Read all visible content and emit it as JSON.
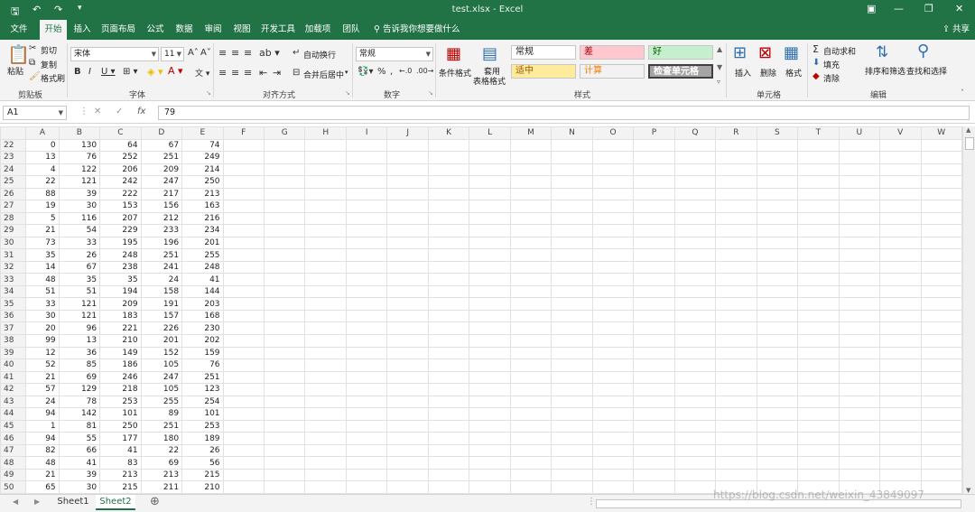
{
  "window": {
    "title": "test.xlsx  -  Excel",
    "save_icon": "save-icon",
    "undo_icon": "undo-icon",
    "redo_icon": "redo-icon",
    "customize_icon": "qat-customize-icon"
  },
  "tabs": [
    "文件",
    "开始",
    "插入",
    "页面布局",
    "公式",
    "数据",
    "审阅",
    "视图",
    "开发工具",
    "加载项",
    "团队"
  ],
  "tell_me": "告诉我你想要做什么",
  "share": "共享",
  "ribbon": {
    "clipboard": {
      "label": "剪贴板",
      "paste": "粘贴",
      "cut": "剪切",
      "copy": "复制",
      "format_painter": "格式刷"
    },
    "font": {
      "label": "字体",
      "name": "宋体",
      "size": "11"
    },
    "alignment": {
      "label": "对齐方式",
      "wrap": "自动换行",
      "merge": "合并后居中"
    },
    "number": {
      "label": "数字",
      "format": "常规"
    },
    "styles": {
      "label": "样式",
      "conditional": "条件格式",
      "table_format_1": "套用",
      "table_format_2": "表格格式",
      "cells": [
        {
          "text": "常规",
          "bg": "#ffffff",
          "color": "#222222"
        },
        {
          "text": "差",
          "bg": "#ffc7ce",
          "color": "#9c0006"
        },
        {
          "text": "好",
          "bg": "#c6efce",
          "color": "#006100"
        },
        {
          "text": "适中",
          "bg": "#ffeb9c",
          "color": "#9c5700"
        },
        {
          "text": "计算",
          "bg": "#f2f2f2",
          "color": "#fa7d00"
        },
        {
          "text": "检查单元格",
          "bg": "#a5a5a5",
          "color": "#ffffff"
        }
      ]
    },
    "cells": {
      "label": "单元格",
      "insert": "插入",
      "delete": "删除",
      "format": "格式"
    },
    "editing": {
      "label": "编辑",
      "autosum": "自动求和",
      "fill": "填充",
      "clear": "清除",
      "sort_filter": "排序和筛选",
      "find_select": "查找和选择"
    }
  },
  "formula_bar": {
    "name_box": "A1",
    "cancel": "✕",
    "enter": "✓",
    "fx": "fx",
    "value": "79"
  },
  "columns": [
    "A",
    "B",
    "C",
    "D",
    "E",
    "F",
    "G",
    "H",
    "I",
    "J",
    "K",
    "L",
    "M",
    "N",
    "O",
    "P",
    "Q",
    "R",
    "S",
    "T",
    "U",
    "V",
    "W"
  ],
  "rows": [
    {
      "n": 22,
      "v": [
        0,
        130,
        64,
        67,
        74
      ]
    },
    {
      "n": 23,
      "v": [
        13,
        76,
        252,
        251,
        249
      ]
    },
    {
      "n": 24,
      "v": [
        4,
        122,
        206,
        209,
        214
      ]
    },
    {
      "n": 25,
      "v": [
        22,
        121,
        242,
        247,
        250
      ]
    },
    {
      "n": 26,
      "v": [
        88,
        39,
        222,
        217,
        213
      ]
    },
    {
      "n": 27,
      "v": [
        19,
        30,
        153,
        156,
        163
      ]
    },
    {
      "n": 28,
      "v": [
        5,
        116,
        207,
        212,
        216
      ]
    },
    {
      "n": 29,
      "v": [
        21,
        54,
        229,
        233,
        234
      ]
    },
    {
      "n": 30,
      "v": [
        73,
        33,
        195,
        196,
        201
      ]
    },
    {
      "n": 31,
      "v": [
        35,
        26,
        248,
        251,
        255
      ]
    },
    {
      "n": 32,
      "v": [
        14,
        67,
        238,
        241,
        248
      ]
    },
    {
      "n": 33,
      "v": [
        48,
        35,
        35,
        24,
        41
      ]
    },
    {
      "n": 34,
      "v": [
        51,
        51,
        194,
        158,
        144
      ]
    },
    {
      "n": 35,
      "v": [
        33,
        121,
        209,
        191,
        203
      ]
    },
    {
      "n": 36,
      "v": [
        30,
        121,
        183,
        157,
        168
      ]
    },
    {
      "n": 37,
      "v": [
        20,
        96,
        221,
        226,
        230
      ]
    },
    {
      "n": 38,
      "v": [
        99,
        13,
        210,
        201,
        202
      ]
    },
    {
      "n": 39,
      "v": [
        12,
        36,
        149,
        152,
        159
      ]
    },
    {
      "n": 40,
      "v": [
        52,
        85,
        186,
        105,
        76
      ]
    },
    {
      "n": 41,
      "v": [
        21,
        69,
        246,
        247,
        251
      ]
    },
    {
      "n": 42,
      "v": [
        57,
        129,
        218,
        105,
        123
      ]
    },
    {
      "n": 43,
      "v": [
        24,
        78,
        253,
        255,
        254
      ]
    },
    {
      "n": 44,
      "v": [
        94,
        142,
        101,
        89,
        101
      ]
    },
    {
      "n": 45,
      "v": [
        1,
        81,
        250,
        251,
        253
      ]
    },
    {
      "n": 46,
      "v": [
        94,
        55,
        177,
        180,
        189
      ]
    },
    {
      "n": 47,
      "v": [
        82,
        66,
        41,
        22,
        26
      ]
    },
    {
      "n": 48,
      "v": [
        48,
        41,
        83,
        69,
        56
      ]
    },
    {
      "n": 49,
      "v": [
        21,
        39,
        213,
        213,
        215
      ]
    },
    {
      "n": 50,
      "v": [
        65,
        30,
        215,
        211,
        210
      ]
    }
  ],
  "sheets": [
    "Sheet1",
    "Sheet2"
  ],
  "active_sheet": "Sheet2",
  "add_sheet": "⊕",
  "watermark": "https://blog.csdn.net/weixin_43849097",
  "colors": {
    "accent": "#217346"
  }
}
